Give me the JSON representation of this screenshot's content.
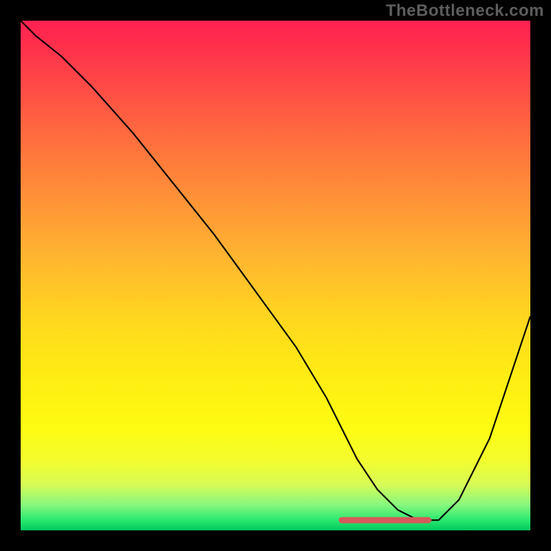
{
  "watermark": "TheBottleneck.com",
  "chart_data": {
    "type": "line",
    "title": "",
    "xlabel": "",
    "ylabel": "",
    "xlim": [
      0,
      100
    ],
    "ylim": [
      0,
      100
    ],
    "series": [
      {
        "name": "curve",
        "x": [
          0,
          3,
          8,
          14,
          22,
          30,
          38,
          46,
          54,
          60,
          63,
          66,
          70,
          74,
          78,
          82,
          86,
          92,
          100
        ],
        "y": [
          100,
          97,
          93,
          87,
          78,
          68,
          58,
          47,
          36,
          26,
          20,
          14,
          8,
          4,
          2,
          2,
          6,
          18,
          42
        ]
      }
    ],
    "flat_segment": {
      "x": [
        63,
        80
      ],
      "y_level": 2,
      "color": "#d55a5a",
      "stroke_width": 9
    },
    "gradient_stops": [
      {
        "pos": 0,
        "color": "#ff2050"
      },
      {
        "pos": 8,
        "color": "#ff3a4a"
      },
      {
        "pos": 22,
        "color": "#ff6a3f"
      },
      {
        "pos": 34,
        "color": "#ff8f38"
      },
      {
        "pos": 46,
        "color": "#ffb430"
      },
      {
        "pos": 58,
        "color": "#ffd61f"
      },
      {
        "pos": 70,
        "color": "#ffed12"
      },
      {
        "pos": 80,
        "color": "#fdfc12"
      },
      {
        "pos": 86,
        "color": "#f4fc2c"
      },
      {
        "pos": 91,
        "color": "#d7fb56"
      },
      {
        "pos": 95,
        "color": "#88f77e"
      },
      {
        "pos": 98,
        "color": "#29e96f"
      },
      {
        "pos": 100,
        "color": "#00c95d"
      }
    ]
  }
}
